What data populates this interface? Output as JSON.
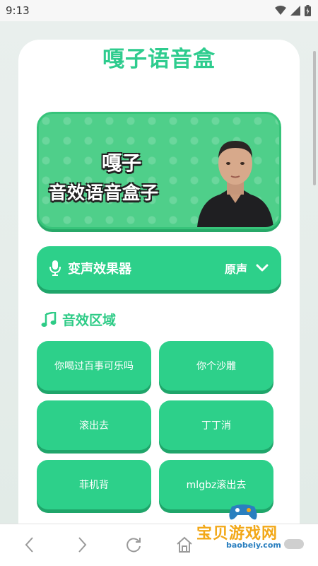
{
  "status_bar": {
    "time": "9:13"
  },
  "app": {
    "title": "嘎子语音盒"
  },
  "banner": {
    "line1": "嘎子",
    "line2": "音效语音盒子"
  },
  "voice_changer": {
    "label": "变声效果器",
    "value": "原声",
    "icon": "mic-icon"
  },
  "section": {
    "title": "音效区域",
    "icon": "music-note-icon"
  },
  "sounds": [
    {
      "label": "你喝过百事可乐吗"
    },
    {
      "label": "你个沙雕"
    },
    {
      "label": "滚出去"
    },
    {
      "label": "丁丁消"
    },
    {
      "label": "菲机背"
    },
    {
      "label": "mlgbz滚出去"
    }
  ],
  "nav": {
    "icons": [
      "back-icon",
      "forward-icon",
      "refresh-icon",
      "home-icon"
    ]
  },
  "watermark": {
    "text": "宝贝游戏网",
    "sub": "baobeiy.com"
  },
  "colors": {
    "accent": "#2dd08a",
    "title": "#2ecc8e",
    "banner": "#4fcf8a"
  }
}
